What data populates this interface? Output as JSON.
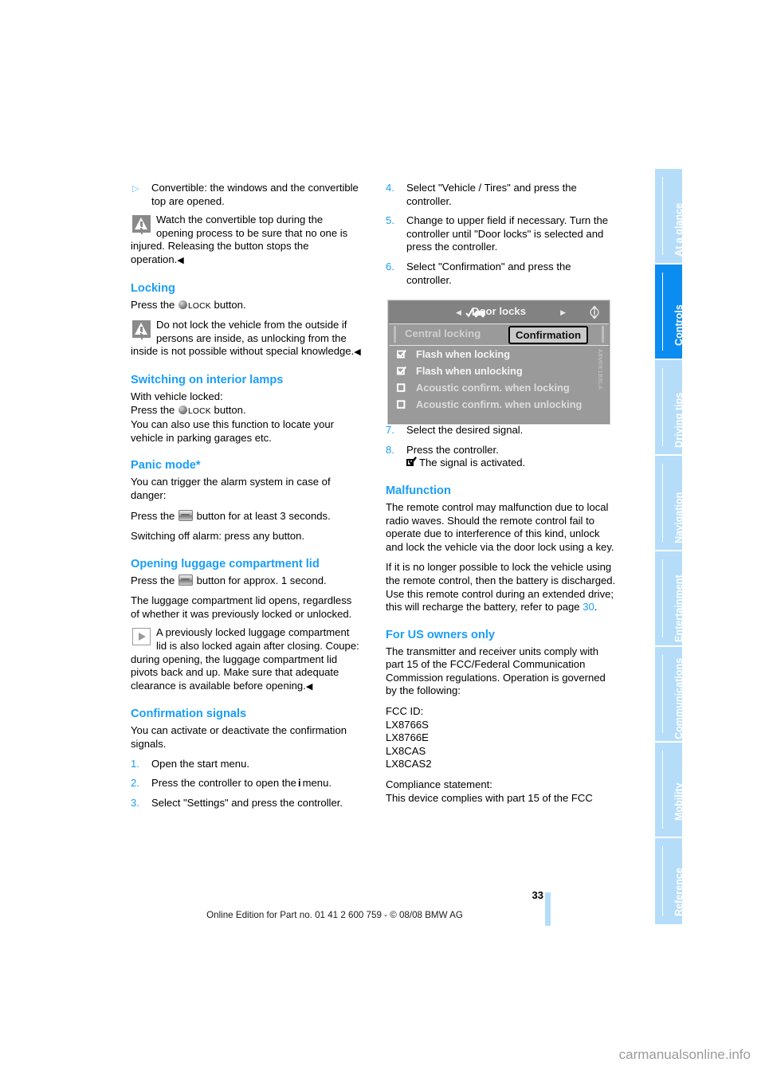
{
  "sidebar": {
    "tabs": [
      {
        "label": "At a glance",
        "active": false
      },
      {
        "label": "Controls",
        "active": true
      },
      {
        "label": "Driving tips",
        "active": false
      },
      {
        "label": "Navigation",
        "active": false
      },
      {
        "label": "Entertainment",
        "active": false
      },
      {
        "label": "Communications",
        "active": false
      },
      {
        "label": "Mobility",
        "active": false
      },
      {
        "label": "Reference",
        "active": false
      }
    ],
    "active_color": "#0b8cf0",
    "inactive_color": "#b5ddfa"
  },
  "left_column": {
    "bullet_convertible": "Convertible: the windows and the convertible top are opened.",
    "warning_convertible": "Watch the convertible top during the opening process to be sure that no one is injured. Releasing the button stops the operation.",
    "heading_locking": "Locking",
    "locking_press_pre": "Press the",
    "locking_lock_word": "LOCK",
    "locking_press_post": "button.",
    "warning_locking": "Do not lock the vehicle from the outside if persons are inside, as unlocking from the inside is not possible without special knowledge.",
    "heading_interior_lamps": "Switching on interior lamps",
    "interior_line1": "With vehicle locked:",
    "interior_line2_pre": "Press the",
    "interior_line2_post": "button.",
    "interior_line3": "You can also use this function to locate your vehicle in parking garages etc.",
    "heading_panic": "Panic mode*",
    "panic_line1": "You can trigger the alarm system in case of danger:",
    "panic_line2_pre": "Press the",
    "panic_line2_post": "button for at least 3 seconds.",
    "panic_line3": "Switching off alarm: press any button.",
    "heading_luggage": "Opening luggage compartment lid",
    "luggage_line1_pre": "Press the",
    "luggage_line1_post": "button for approx. 1 second.",
    "luggage_line2": "The luggage compartment lid opens, regardless of whether it was previously locked or unlocked.",
    "luggage_note": "A previously locked luggage compartment lid is also locked again after closing. Coupe: during opening, the luggage compartment lid pivots back and up. Make sure that adequate clearance is available before opening.",
    "heading_confirmation": "Confirmation signals",
    "confirmation_intro": "You can activate or deactivate the confirmation signals.",
    "steps": [
      {
        "num": "1.",
        "text": "Open the start menu."
      },
      {
        "num": "2.",
        "text_pre": "Press the controller to open the",
        "icon": "info-i-icon",
        "text_post": "menu."
      },
      {
        "num": "3.",
        "text": "Select \"Settings\" and press the controller."
      }
    ]
  },
  "right_column": {
    "steps_top": [
      {
        "num": "4.",
        "text": "Select \"Vehicle / Tires\" and press the controller."
      },
      {
        "num": "5.",
        "text": "Change to upper field if necessary. Turn the controller until \"Door locks\" is selected and press the controller."
      },
      {
        "num": "6.",
        "text": "Select \"Confirmation\" and press the controller."
      }
    ],
    "steps_bottom": [
      {
        "num": "7.",
        "text": "Select the desired signal."
      },
      {
        "num": "8.",
        "text": "Press the controller.",
        "sub": "The signal is activated."
      }
    ],
    "heading_malfunction": "Malfunction",
    "malfunction_p1": "The remote control may malfunction due to local radio waves. Should the remote control fail to operate due to interference of this kind, unlock and lock the vehicle via the door lock using a key.",
    "malfunction_p2_pre": "If it is no longer possible to lock the vehicle using the remote control, then the battery is discharged. Use this remote control during an extended drive; this will recharge the battery, refer to page",
    "malfunction_p2_ref": "30",
    "malfunction_p2_post": ".",
    "heading_us_owners": "For US owners only",
    "us_p1": "The transmitter and receiver units comply with part 15 of the FCC/Federal Communication Commission regulations. Operation is governed by the following:",
    "fcc_id_label": "FCC ID:",
    "fcc_ids": [
      "LX8766S",
      "LX8766E",
      "LX8CAS",
      "LX8CAS2"
    ],
    "compliance_label": "Compliance statement:",
    "compliance_text": "This device complies with part 15 of the FCC"
  },
  "figure": {
    "header_title": "Door locks",
    "tab_inactive": "Central locking",
    "tab_active": "Confirmation",
    "rows": [
      {
        "label": "Flash when locking",
        "checked": true
      },
      {
        "label": "Flash when unlocking",
        "checked": true
      },
      {
        "label": "Acoustic confirm. when locking",
        "checked": false
      },
      {
        "label": "Acoustic confirm. when unlocking",
        "checked": false
      }
    ],
    "image_code": "A8M0E1B8LA"
  },
  "footer": {
    "page_number": "33",
    "edition_line": "Online Edition for Part no. 01 41 2 600 759 - © 08/08 BMW AG"
  },
  "watermark": "carmanualsonline.info"
}
